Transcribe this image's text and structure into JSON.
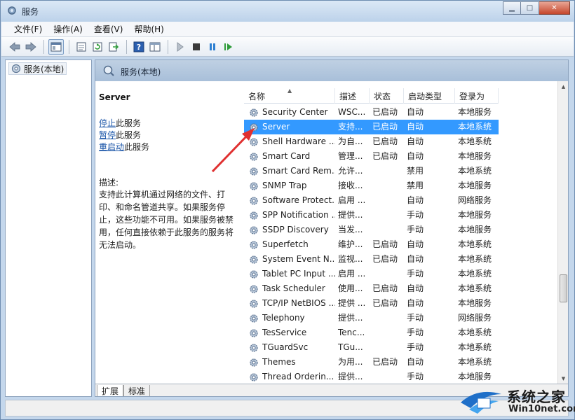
{
  "window": {
    "title": "服务",
    "controls": [
      "minimize",
      "maximize",
      "close"
    ]
  },
  "menu": [
    "文件(F)",
    "操作(A)",
    "查看(V)",
    "帮助(H)"
  ],
  "toolbar": {
    "icons": [
      "back-arrow-icon",
      "forward-arrow-icon",
      "console-tree-icon",
      "properties-icon",
      "refresh-icon",
      "export-icon",
      "help-icon",
      "view-icon",
      "start-icon",
      "stop-icon",
      "pause-icon",
      "restart-icon"
    ]
  },
  "tree": {
    "root_label": "服务(本地)"
  },
  "main": {
    "header_title": "服务(本地)",
    "selected_service": {
      "name": "Server",
      "actions": [
        {
          "link": "停止",
          "suffix": "此服务"
        },
        {
          "link": "暂停",
          "suffix": "此服务"
        },
        {
          "link": "重启动",
          "suffix": "此服务"
        }
      ],
      "description_label": "描述:",
      "description": "支持此计算机通过网络的文件、打印、和命名管道共享。如果服务停止，这些功能不可用。如果服务被禁用，任何直接依赖于此服务的服务将无法启动。"
    },
    "columns": [
      "名称",
      "描述",
      "状态",
      "启动类型",
      "登录为"
    ],
    "rows": [
      {
        "name": "Security Center",
        "desc": "WSC...",
        "status": "已启动",
        "start": "自动",
        "logon": "本地服务"
      },
      {
        "name": "Server",
        "desc": "支持...",
        "status": "已启动",
        "start": "自动",
        "logon": "本地系统",
        "selected": true
      },
      {
        "name": "Shell Hardware ...",
        "desc": "为自...",
        "status": "已启动",
        "start": "自动",
        "logon": "本地系统"
      },
      {
        "name": "Smart Card",
        "desc": "管理...",
        "status": "已启动",
        "start": "自动",
        "logon": "本地服务"
      },
      {
        "name": "Smart Card Rem...",
        "desc": "允许...",
        "status": "",
        "start": "禁用",
        "logon": "本地系统"
      },
      {
        "name": "SNMP Trap",
        "desc": "接收...",
        "status": "",
        "start": "禁用",
        "logon": "本地服务"
      },
      {
        "name": "Software Protect...",
        "desc": "启用 ...",
        "status": "",
        "start": "自动",
        "logon": "网络服务"
      },
      {
        "name": "SPP Notification ...",
        "desc": "提供...",
        "status": "",
        "start": "手动",
        "logon": "本地服务"
      },
      {
        "name": "SSDP Discovery",
        "desc": "当发...",
        "status": "",
        "start": "手动",
        "logon": "本地服务"
      },
      {
        "name": "Superfetch",
        "desc": "维护...",
        "status": "已启动",
        "start": "自动",
        "logon": "本地系统"
      },
      {
        "name": "System Event N...",
        "desc": "监视...",
        "status": "已启动",
        "start": "自动",
        "logon": "本地系统"
      },
      {
        "name": "Tablet PC Input ...",
        "desc": "启用 ...",
        "status": "",
        "start": "手动",
        "logon": "本地系统"
      },
      {
        "name": "Task Scheduler",
        "desc": "使用...",
        "status": "已启动",
        "start": "自动",
        "logon": "本地系统"
      },
      {
        "name": "TCP/IP NetBIOS ...",
        "desc": "提供 ...",
        "status": "已启动",
        "start": "自动",
        "logon": "本地服务"
      },
      {
        "name": "Telephony",
        "desc": "提供...",
        "status": "",
        "start": "手动",
        "logon": "网络服务"
      },
      {
        "name": "TesService",
        "desc": "Tenc...",
        "status": "",
        "start": "手动",
        "logon": "本地系统"
      },
      {
        "name": "TGuardSvc",
        "desc": "TGu...",
        "status": "",
        "start": "手动",
        "logon": "本地系统"
      },
      {
        "name": "Themes",
        "desc": "为用...",
        "status": "已启动",
        "start": "自动",
        "logon": "本地系统"
      },
      {
        "name": "Thread Orderin...",
        "desc": "提供...",
        "status": "",
        "start": "手动",
        "logon": "本地服务"
      }
    ],
    "tabs": [
      "扩展",
      "标准"
    ]
  },
  "watermark": {
    "brand": "系统之家",
    "url": "Win10net.com"
  },
  "colors": {
    "selection": "#3399ff",
    "link": "#1a55a8",
    "annotation_arrow": "#e03030"
  }
}
